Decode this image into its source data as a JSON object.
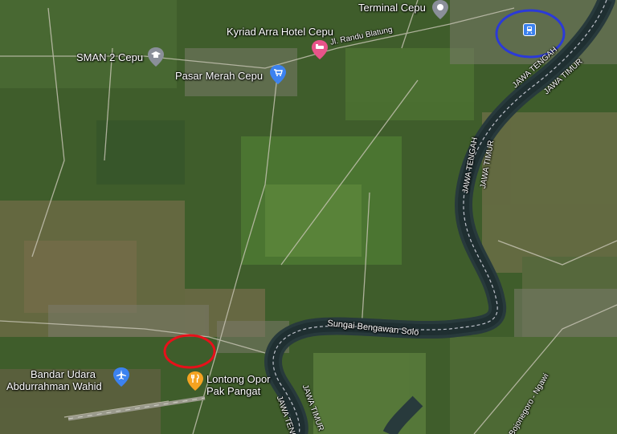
{
  "places": {
    "terminal": {
      "label": "Terminal Cepu",
      "icon": "bus-station-pin-icon",
      "color": "#8a8f99"
    },
    "hotel": {
      "label": "Kyriad Arra Hotel Cepu",
      "icon": "hotel-pin-icon",
      "color": "#e8548a"
    },
    "school": {
      "label": "SMAN 2 Cepu",
      "icon": "school-pin-icon",
      "color": "#8a8f99"
    },
    "market": {
      "label": "Pasar Merah Cepu",
      "icon": "shopping-pin-icon",
      "color": "#3c82f0"
    },
    "airport": {
      "label_line1": "Bandar Udara",
      "label_line2": "Abdurrahman Wahid",
      "icon": "airport-pin-icon",
      "color": "#3c82f0"
    },
    "restaurant": {
      "label_line1": "Lontong Opor",
      "label_line2": "Pak Pangat",
      "icon": "restaurant-pin-icon",
      "color": "#f4a321"
    },
    "train_station": {
      "icon": "train-station-icon",
      "color": "#3c82f0"
    }
  },
  "roads": {
    "randu_blatung": "Jl. Randu Blatung",
    "bojonegoro_ngawi": "Bojonegoro - Ngawi"
  },
  "river": {
    "label": "Sungai Bengawan Solo"
  },
  "borders": {
    "jateng_1": "JAWA TENGAH",
    "jatim_1": "JAWA TIMUR",
    "jateng_2": "JAWA TENGAH",
    "jatim_2": "JAWA TIMUR",
    "jateng_3": "JAWA TENG",
    "jatim_3": "JAWA TIMUR"
  },
  "annotations": {
    "blue_circle_color": "#2b3ad8",
    "red_circle_color": "#e8101a"
  }
}
